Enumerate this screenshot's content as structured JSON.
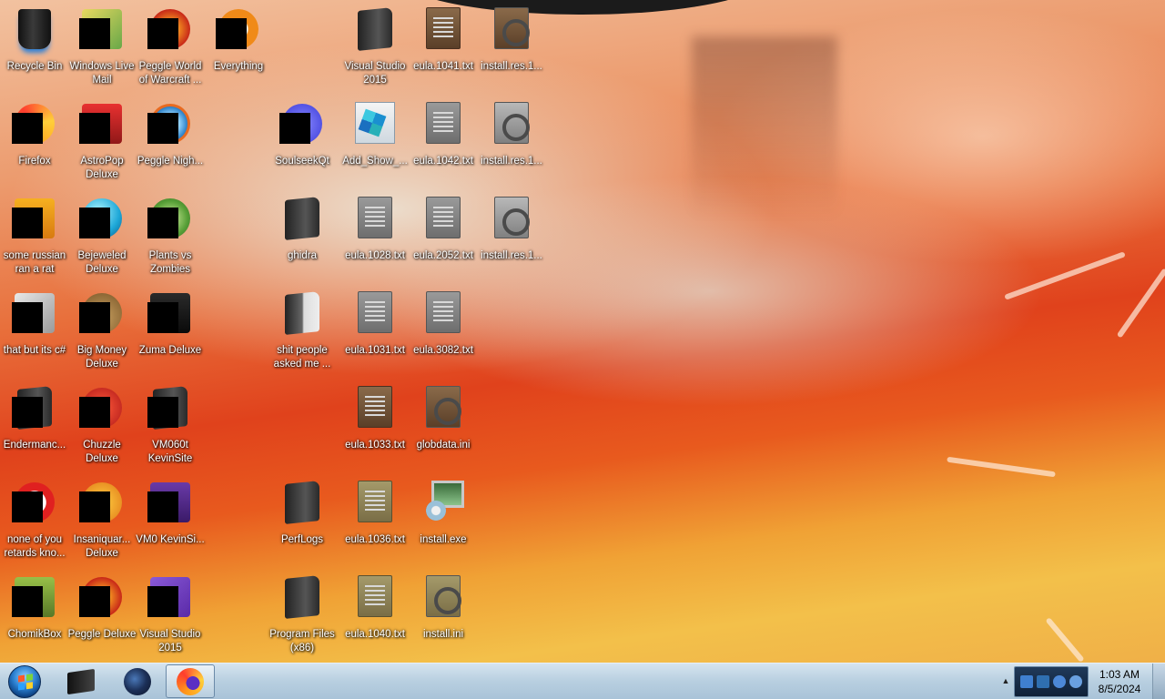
{
  "desktop": {
    "icons": [
      {
        "label": "Recycle Bin",
        "icon": "recycle-bin-icon"
      },
      {
        "label": "Windows Live Mail",
        "icon": "mail-icon"
      },
      {
        "label": "Peggle World of Warcraft ...",
        "icon": "peggle-icon"
      },
      {
        "label": "Everything",
        "icon": "search-app-icon"
      },
      {
        "label": "Visual Studio 2015",
        "icon": "folder-icon"
      },
      {
        "label": "eula.1041.txt",
        "icon": "text-file-icon"
      },
      {
        "label": "install.res.1...",
        "icon": "settings-file-icon"
      },
      {
        "label": "Firefox",
        "icon": "firefox-icon"
      },
      {
        "label": "AstroPop Deluxe",
        "icon": "game-icon"
      },
      {
        "label": "Peggle Nigh...",
        "icon": "peggle-icon"
      },
      {
        "label": "SoulseekQt",
        "icon": "soulseek-icon"
      },
      {
        "label": "Add_Show_...",
        "icon": "registry-file-icon"
      },
      {
        "label": "eula.1042.txt",
        "icon": "text-file-icon"
      },
      {
        "label": "install.res.1...",
        "icon": "settings-file-icon"
      },
      {
        "label": "some russian ran a rat",
        "icon": "folder-icon"
      },
      {
        "label": "Bejeweled Deluxe",
        "icon": "gem-icon"
      },
      {
        "label": "Plants vs Zombies",
        "icon": "plant-icon"
      },
      {
        "label": "ghidra",
        "icon": "folder-icon"
      },
      {
        "label": "eula.1028.txt",
        "icon": "text-file-icon"
      },
      {
        "label": "eula.2052.txt",
        "icon": "text-file-icon"
      },
      {
        "label": "install.res.1...",
        "icon": "settings-file-icon"
      },
      {
        "label": "that but its c#",
        "icon": "folder-icon"
      },
      {
        "label": "Big Money Deluxe",
        "icon": "money-bag-icon"
      },
      {
        "label": "Zuma Deluxe",
        "icon": "game-icon"
      },
      {
        "label": "shit people asked me ...",
        "icon": "folder-icon"
      },
      {
        "label": "eula.1031.txt",
        "icon": "text-file-icon"
      },
      {
        "label": "eula.3082.txt",
        "icon": "text-file-icon"
      },
      {
        "label": "Endermanc...",
        "icon": "folder-icon"
      },
      {
        "label": "Chuzzle Deluxe",
        "icon": "chuzzle-icon"
      },
      {
        "label": "VM060t KevinSite",
        "icon": "folder-icon"
      },
      {
        "label": "eula.1033.txt",
        "icon": "text-file-icon"
      },
      {
        "label": "globdata.ini",
        "icon": "settings-file-icon"
      },
      {
        "label": "none of you retards kno...",
        "icon": "app-icon"
      },
      {
        "label": "Insaniquar... Deluxe",
        "icon": "fish-icon"
      },
      {
        "label": "VM0 KevinSi...",
        "icon": "folder-icon"
      },
      {
        "label": "PerfLogs",
        "icon": "folder-icon"
      },
      {
        "label": "eula.1036.txt",
        "icon": "text-file-icon"
      },
      {
        "label": "install.exe",
        "icon": "installer-icon"
      },
      {
        "label": "ChomikBox",
        "icon": "chomikbox-icon"
      },
      {
        "label": "Peggle Deluxe",
        "icon": "peggle-icon"
      },
      {
        "label": "Visual Studio 2015",
        "icon": "visual-studio-icon"
      },
      {
        "label": "Program Files (x86)",
        "icon": "folder-icon"
      },
      {
        "label": "eula.1040.txt",
        "icon": "text-file-icon"
      },
      {
        "label": "install.ini",
        "icon": "settings-file-icon"
      }
    ]
  },
  "taskbar": {
    "start_label": "Start",
    "pinned": [
      {
        "name": "Windows Explorer",
        "icon": "explorer-icon"
      },
      {
        "name": "Globe app",
        "icon": "globe-icon"
      },
      {
        "name": "Firefox",
        "icon": "firefox-icon"
      }
    ],
    "clock": {
      "time": "1:03 AM",
      "date": "8/5/2024"
    }
  },
  "colors": {
    "taskbar_top": "#d6e4ef",
    "taskbar_bottom": "#a9c3d8",
    "label_text": "#ffffff"
  }
}
